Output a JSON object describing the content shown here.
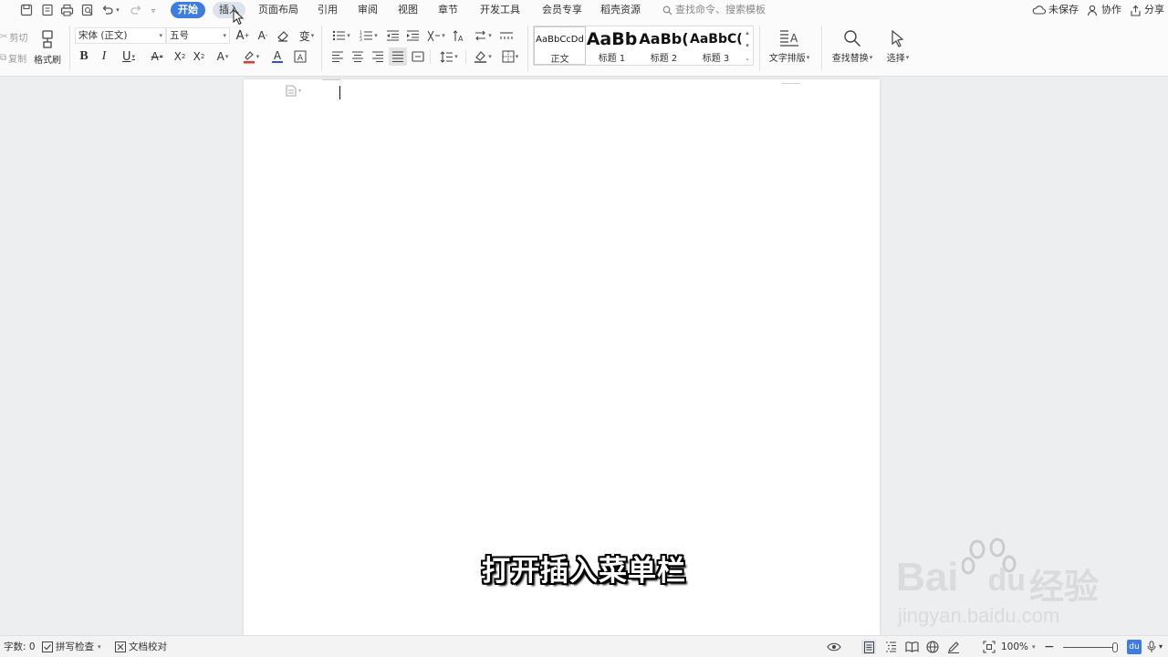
{
  "menu": {
    "tabs": [
      {
        "label": "开始"
      },
      {
        "label": "插入"
      },
      {
        "label": "页面布局"
      },
      {
        "label": "引用"
      },
      {
        "label": "审阅"
      },
      {
        "label": "视图"
      },
      {
        "label": "章节"
      },
      {
        "label": "开发工具"
      },
      {
        "label": "会员专享"
      },
      {
        "label": "稻壳资源"
      }
    ],
    "active_tab": "开始",
    "hover_tab": "插入",
    "search_placeholder": "查找命令、搜索模板",
    "unsaved_label": "未保存",
    "collab_label": "协作",
    "share_label": "分享"
  },
  "ribbon": {
    "cut_label": "剪切",
    "copy_label": "复制",
    "format_painter_label": "格式刷",
    "font_name": "宋体 (正文)",
    "font_size": "五号",
    "styles": [
      {
        "preview": "AaBbCcDd",
        "name": "正文"
      },
      {
        "preview": "AaBb",
        "name": "标题 1"
      },
      {
        "preview": "AaBb(",
        "name": "标题 2"
      },
      {
        "preview": "AaBbC(",
        "name": "标题 3"
      }
    ],
    "text_layout_label": "文字排版",
    "find_replace_label": "查找替换",
    "select_label": "选择"
  },
  "overlay": {
    "subtitle": "打开插入菜单栏",
    "watermark_brand": "Bai",
    "watermark_brand2": "du",
    "watermark_cn": "经验",
    "watermark_url": "jingyan.baidu.com"
  },
  "status": {
    "word_count": "字数: 0",
    "spell_check": "拼写检查",
    "doc_proof": "文档校对",
    "zoom": "100%"
  },
  "colors": {
    "accent": "#3d7ce0",
    "highlight_red": "#e03a2f",
    "font_blue": "#2f55d4"
  }
}
